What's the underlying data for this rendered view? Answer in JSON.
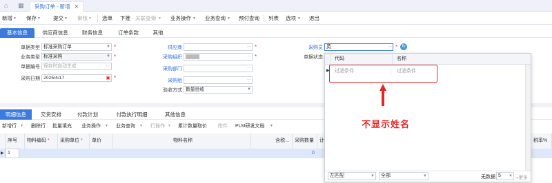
{
  "window_tab": {
    "title": "采购订单 - 新增"
  },
  "toolbar": {
    "items": [
      "新增",
      "保存",
      "提交",
      "审核",
      "选单",
      "下推",
      "关联查询",
      "业务操作",
      "业务查询",
      "预付查询",
      "列表",
      "选项",
      "退出"
    ]
  },
  "header_tabs": [
    "基本信息",
    "供应商信息",
    "财务信息",
    "订单条款",
    "其他"
  ],
  "form": {
    "doc_type_label": "单据类型",
    "doc_type_value": "标准采购订单",
    "biz_type_label": "业务类型",
    "biz_type_value": "标准采购",
    "doc_no_label": "单据编号",
    "doc_no_placeholder": "保存时自动生成",
    "date_label": "采购日期",
    "date_value": "2025/4/17",
    "supplier_label": "供应商",
    "purch_org_label": "采购组织",
    "purch_dept_label": "采购部门",
    "purch_group_label": "采购组",
    "acceptance_label": "验收方式",
    "acceptance_value": "数量验收",
    "buyer_label": "采购员",
    "buyer_value": "英",
    "doc_status_label": "单据状态"
  },
  "bottom_tabs": [
    "明细信息",
    "交货安排",
    "付款计划",
    "付款执行明细",
    "其他信息"
  ],
  "grid_toolbar": [
    "新增行",
    "删除行",
    "批量填充",
    "业务操作",
    "业务查询",
    "行操作",
    "累计数量取价",
    "附件",
    "PLM研发文档"
  ],
  "grid_columns": [
    "序号",
    "物料编码",
    "采购单位",
    "单价",
    "物料名称",
    "含税...",
    "采购数量",
    "计"
  ],
  "grid_extra_column": "税率%",
  "grid_row": {
    "seq": "1",
    "qty": "0"
  },
  "popup": {
    "col_code": "代码",
    "col_name": "名称",
    "filter_placeholder": "过滤条件",
    "filter_placeholder_2": "过滤条件",
    "match_mode": "左匹配",
    "scope": "全部",
    "no_data": "无数据",
    "page_size": "5",
    "more": "更多"
  },
  "annotation": {
    "text": "不显示姓名",
    "color": "#e32626"
  },
  "colors": {
    "accent": "#3b7be0",
    "tab_text": "#2d6fd8",
    "required": "#e23b3b"
  }
}
